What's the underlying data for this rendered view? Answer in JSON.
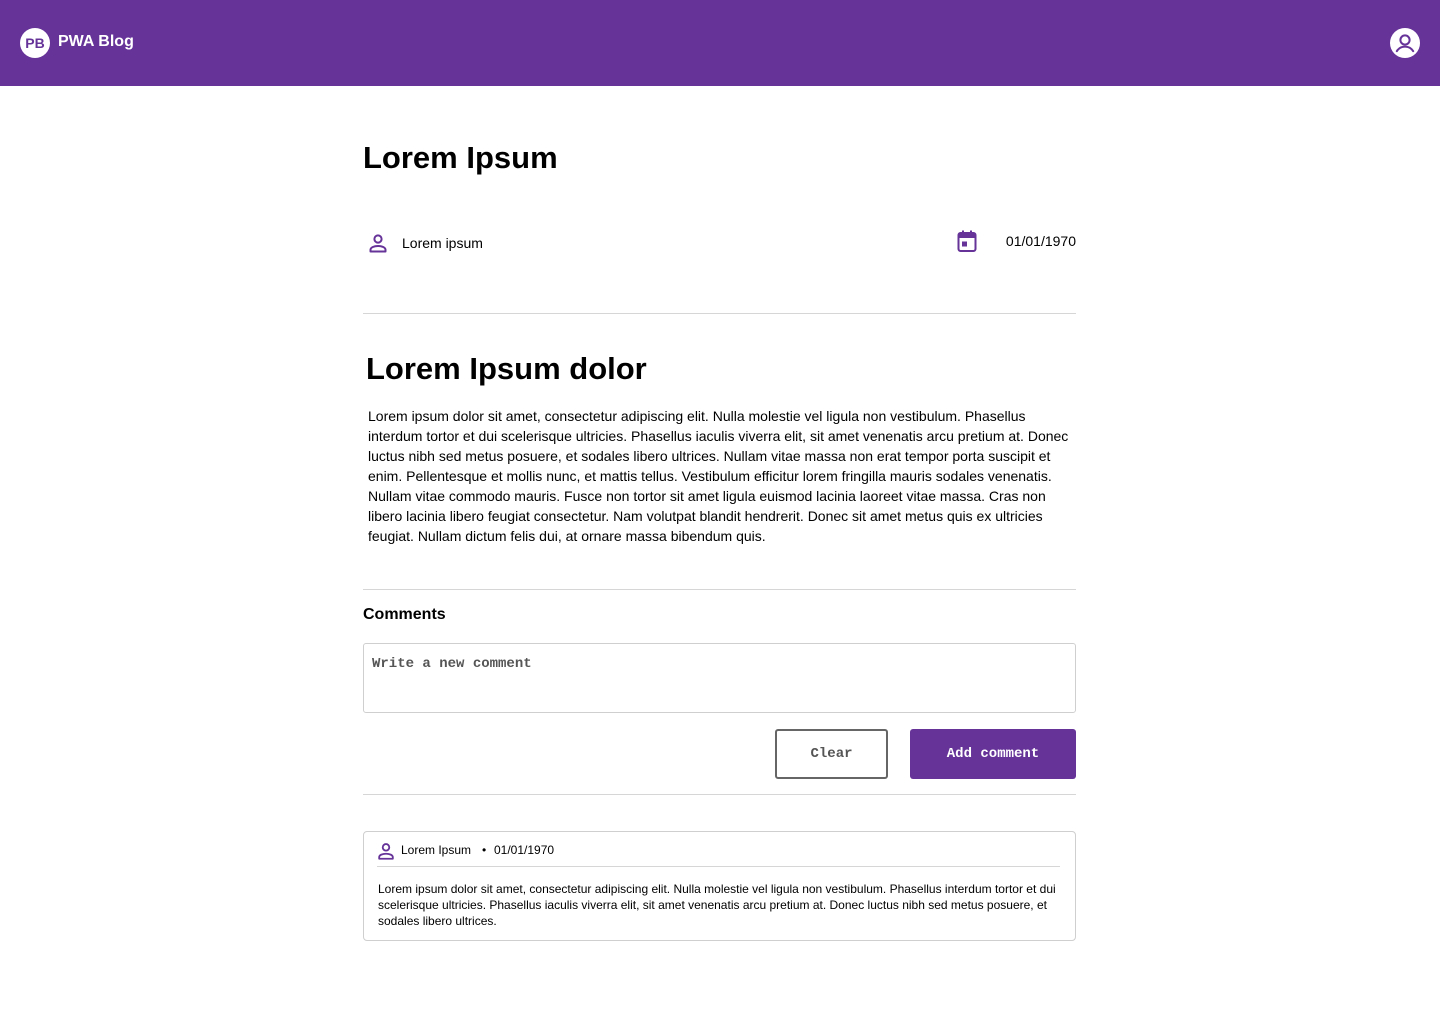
{
  "header": {
    "logo_initials": "PB",
    "app_title": "PWA Blog",
    "avatar_icon": "account-circle-icon",
    "brand_color": "#663399"
  },
  "post": {
    "title": "Lorem Ipsum",
    "author": "Lorem ipsum",
    "date": "01/01/1970",
    "section_heading": "Lorem Ipsum dolor",
    "body": "Lorem ipsum dolor sit amet, consectetur adipiscing elit. Nulla molestie vel ligula non vestibulum. Phasellus interdum tortor et dui scelerisque ultricies. Phasellus iaculis viverra elit, sit amet venenatis arcu pretium at. Donec luctus nibh sed metus posuere, et sodales libero ultrices. Nullam vitae massa non erat tempor porta suscipit et enim. Pellentesque et mollis nunc, et mattis tellus. Vestibulum efficitur lorem fringilla mauris sodales venenatis. Nullam vitae commodo mauris. Fusce non tortor sit amet ligula euismod lacinia laoreet vitae massa. Cras non libero lacinia libero feugiat consectetur. Nam volutpat blandit hendrerit. Donec sit amet metus quis ex ultricies feugiat. Nullam dictum felis dui, at ornare massa bibendum quis."
  },
  "comments_section": {
    "heading": "Comments",
    "input_placeholder": "Write a new comment",
    "input_value": "",
    "clear_label": "Clear",
    "add_label": "Add comment",
    "items": [
      {
        "author": "Lorem Ipsum",
        "separator": "•",
        "date": "01/01/1970",
        "text": "Lorem ipsum dolor sit amet, consectetur adipiscing elit. Nulla molestie vel ligula non vestibulum. Phasellus interdum tortor et dui scelerisque ultricies. Phasellus iaculis viverra elit, sit amet venenatis arcu pretium at. Donec luctus nibh sed metus posuere, et sodales libero ultrices."
      }
    ]
  },
  "icons": {
    "author": "person-icon",
    "date": "calendar-icon"
  }
}
